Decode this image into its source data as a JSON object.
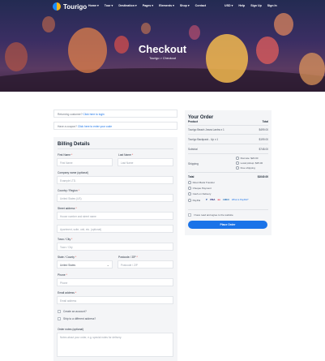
{
  "brand": {
    "name": "Tourigo"
  },
  "nav": {
    "items": [
      "Home ▾",
      "Tour ▾",
      "Destination ▾",
      "Pages ▾",
      "Elements ▾",
      "Shop ▾",
      "Contact"
    ],
    "currency": "USD ▾",
    "help": "Help",
    "signup": "Sign Up",
    "signin": "Sign In"
  },
  "hero": {
    "title": "Checkout",
    "crumb_home": "Tourigo",
    "crumb_sep": ">",
    "crumb_current": "Checkout"
  },
  "notices": {
    "returning": "Returning customer?",
    "returning_link": "Click here to login",
    "coupon": "Have a coupon?",
    "coupon_link": "Click here to enter your code"
  },
  "billing": {
    "title": "Billing Details",
    "first_name_label": "First Name",
    "first_name_ph": "First Name",
    "last_name_label": "Last Name",
    "last_name_ph": "Last Name",
    "company_label": "Company name (optional)",
    "company_ph": "Example LTD.",
    "country_label": "Country / Region",
    "country_value": "United States (US)",
    "street_label": "Street address",
    "street_ph": "House number and street name",
    "apt_ph": "Apartment, suite, unit, etc. (optional)",
    "city_label": "Town / City",
    "city_ph": "Town / City",
    "state_label": "State / County",
    "state_value": "United States",
    "zip_label": "Postcode / ZIP",
    "zip_ph": "Postcode / ZIP",
    "phone_label": "Phone",
    "phone_ph": "Phone",
    "email_label": "Email address",
    "email_ph": "Email address",
    "create_account": "Create an account?",
    "ship_different": "Ship to a different address?",
    "notes_label": "Order notes (optional)",
    "notes_ph": "Notes about your order, e.g. special notes for delivery."
  },
  "order": {
    "title": "Your Order",
    "col_product": "Product",
    "col_total": "Total",
    "items": [
      {
        "name": "Tourigo Beach Jowra Lantra x 1",
        "price": "$499.00"
      },
      {
        "name": "Tourigo Backpack - Up x 1",
        "price": "$199.00"
      }
    ],
    "subtotal_label": "Subtotal",
    "subtotal_value": "$748.00",
    "shipping_label": "Shipping",
    "shipping_options": [
      "Flat rate: $20.00",
      "Local pickup: $25.00",
      "Free shipping"
    ],
    "total_label": "Total",
    "total_value": "$1040.00",
    "payments": [
      "Direct Bank Transfer",
      "Cheque Payment",
      "Cash on Delivery",
      "PayPal"
    ],
    "pay_what": "What is PayPal?",
    "terms": "I have read and agree to the website",
    "place_order": "Place Order"
  },
  "colors": {
    "accent": "#1a73e8",
    "panel": "#f4f5f7"
  }
}
